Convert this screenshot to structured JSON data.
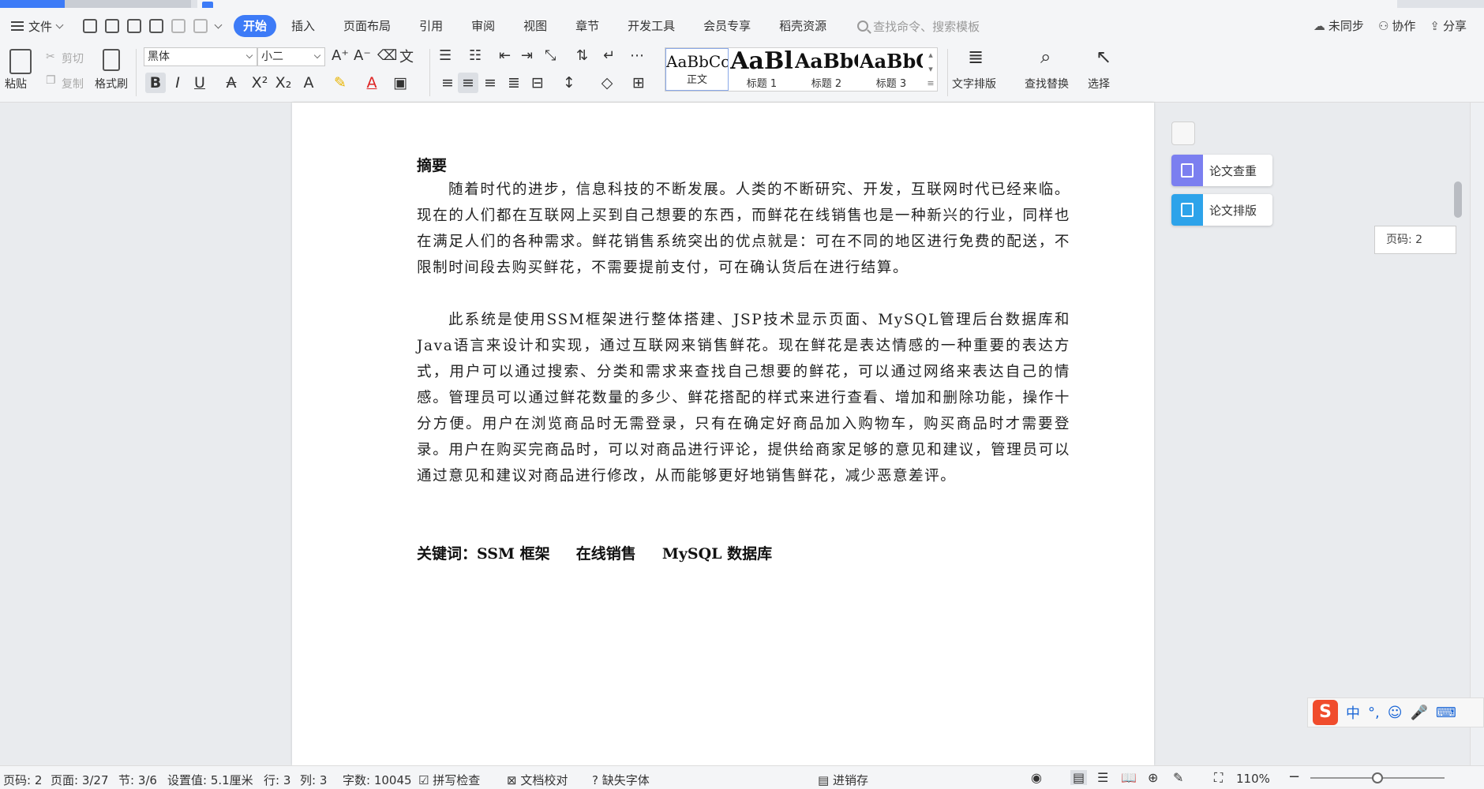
{
  "menu": {
    "file_label": "文件",
    "tabs": [
      "开始",
      "插入",
      "页面布局",
      "引用",
      "审阅",
      "视图",
      "章节",
      "开发工具",
      "会员专享",
      "稻壳资源"
    ],
    "active_tab": "开始",
    "search_placeholder": "查找命令、搜索模板",
    "sync_label": "未同步",
    "collab_label": "协作",
    "share_label": "分享"
  },
  "ribbon": {
    "paste": "粘贴",
    "cut": "剪切",
    "copy": "复制",
    "format_painter": "格式刷",
    "font_name": "黑体",
    "font_size": "小二",
    "styles": [
      {
        "preview": "AaBbCcDd",
        "name": "正文"
      },
      {
        "preview": "AaBl",
        "name": "标题 1"
      },
      {
        "preview": "AaBbC",
        "name": "标题 2"
      },
      {
        "preview": "AaBbC",
        "name": "标题 3"
      }
    ],
    "text_layout": "文字排版",
    "find_replace": "查找替换",
    "select": "选择"
  },
  "document": {
    "abstract_title": "摘要",
    "para1": "随着时代的进步，信息科技的不断发展。人类的不断研究、开发，互联网时代已经来临。现在的人们都在互联网上买到自己想要的东西，而鲜花在线销售也是一种新兴的行业，同样也在满足人们的各种需求。鲜花销售系统突出的优点就是：可在不同的地区进行免费的配送，不限制时间段去购买鲜花，不需要提前支付，可在确认货后在进行结算。",
    "para2": "此系统是使用SSM框架进行整体搭建、JSP技术显示页面、MySQL管理后台数据库和Java语言来设计和实现，通过互联网来销售鲜花。现在鲜花是表达情感的一种重要的表达方式，用户可以通过搜索、分类和需求来查找自己想要的鲜花，可以通过网络来表达自己的情感。管理员可以通过鲜花数量的多少、鲜花搭配的样式来进行查看、增加和删除功能，操作十分方便。用户在浏览商品时无需登录，只有在确定好商品加入购物车，购买商品时才需要登录。用户在购买完商品时，可以对商品进行评论，提供给商家足够的意见和建议，管理员可以通过意见和建议对商品进行修改，从而能够更好地销售鲜花，减少恶意差评。",
    "keywords": "关键词：SSM 框架     在线销售     MySQL 数据库"
  },
  "side_panel": {
    "thesis_check": "论文查重",
    "thesis_format": "论文排版",
    "page_tooltip": "页码: 2"
  },
  "ime": {
    "logo": "S",
    "mode": "中"
  },
  "status_bar": {
    "page_no": "页码: 2",
    "pages": "页面: 3/27",
    "section": "节: 3/6",
    "set_value": "设置值: 5.1厘米",
    "row": "行: 3",
    "col": "列: 3",
    "word_count": "字数: 10045",
    "spell_check": "拼写检查",
    "doc_proof": "文档校对",
    "missing_font": "缺失字体",
    "save_progress": "进销存",
    "zoom": "110%"
  }
}
